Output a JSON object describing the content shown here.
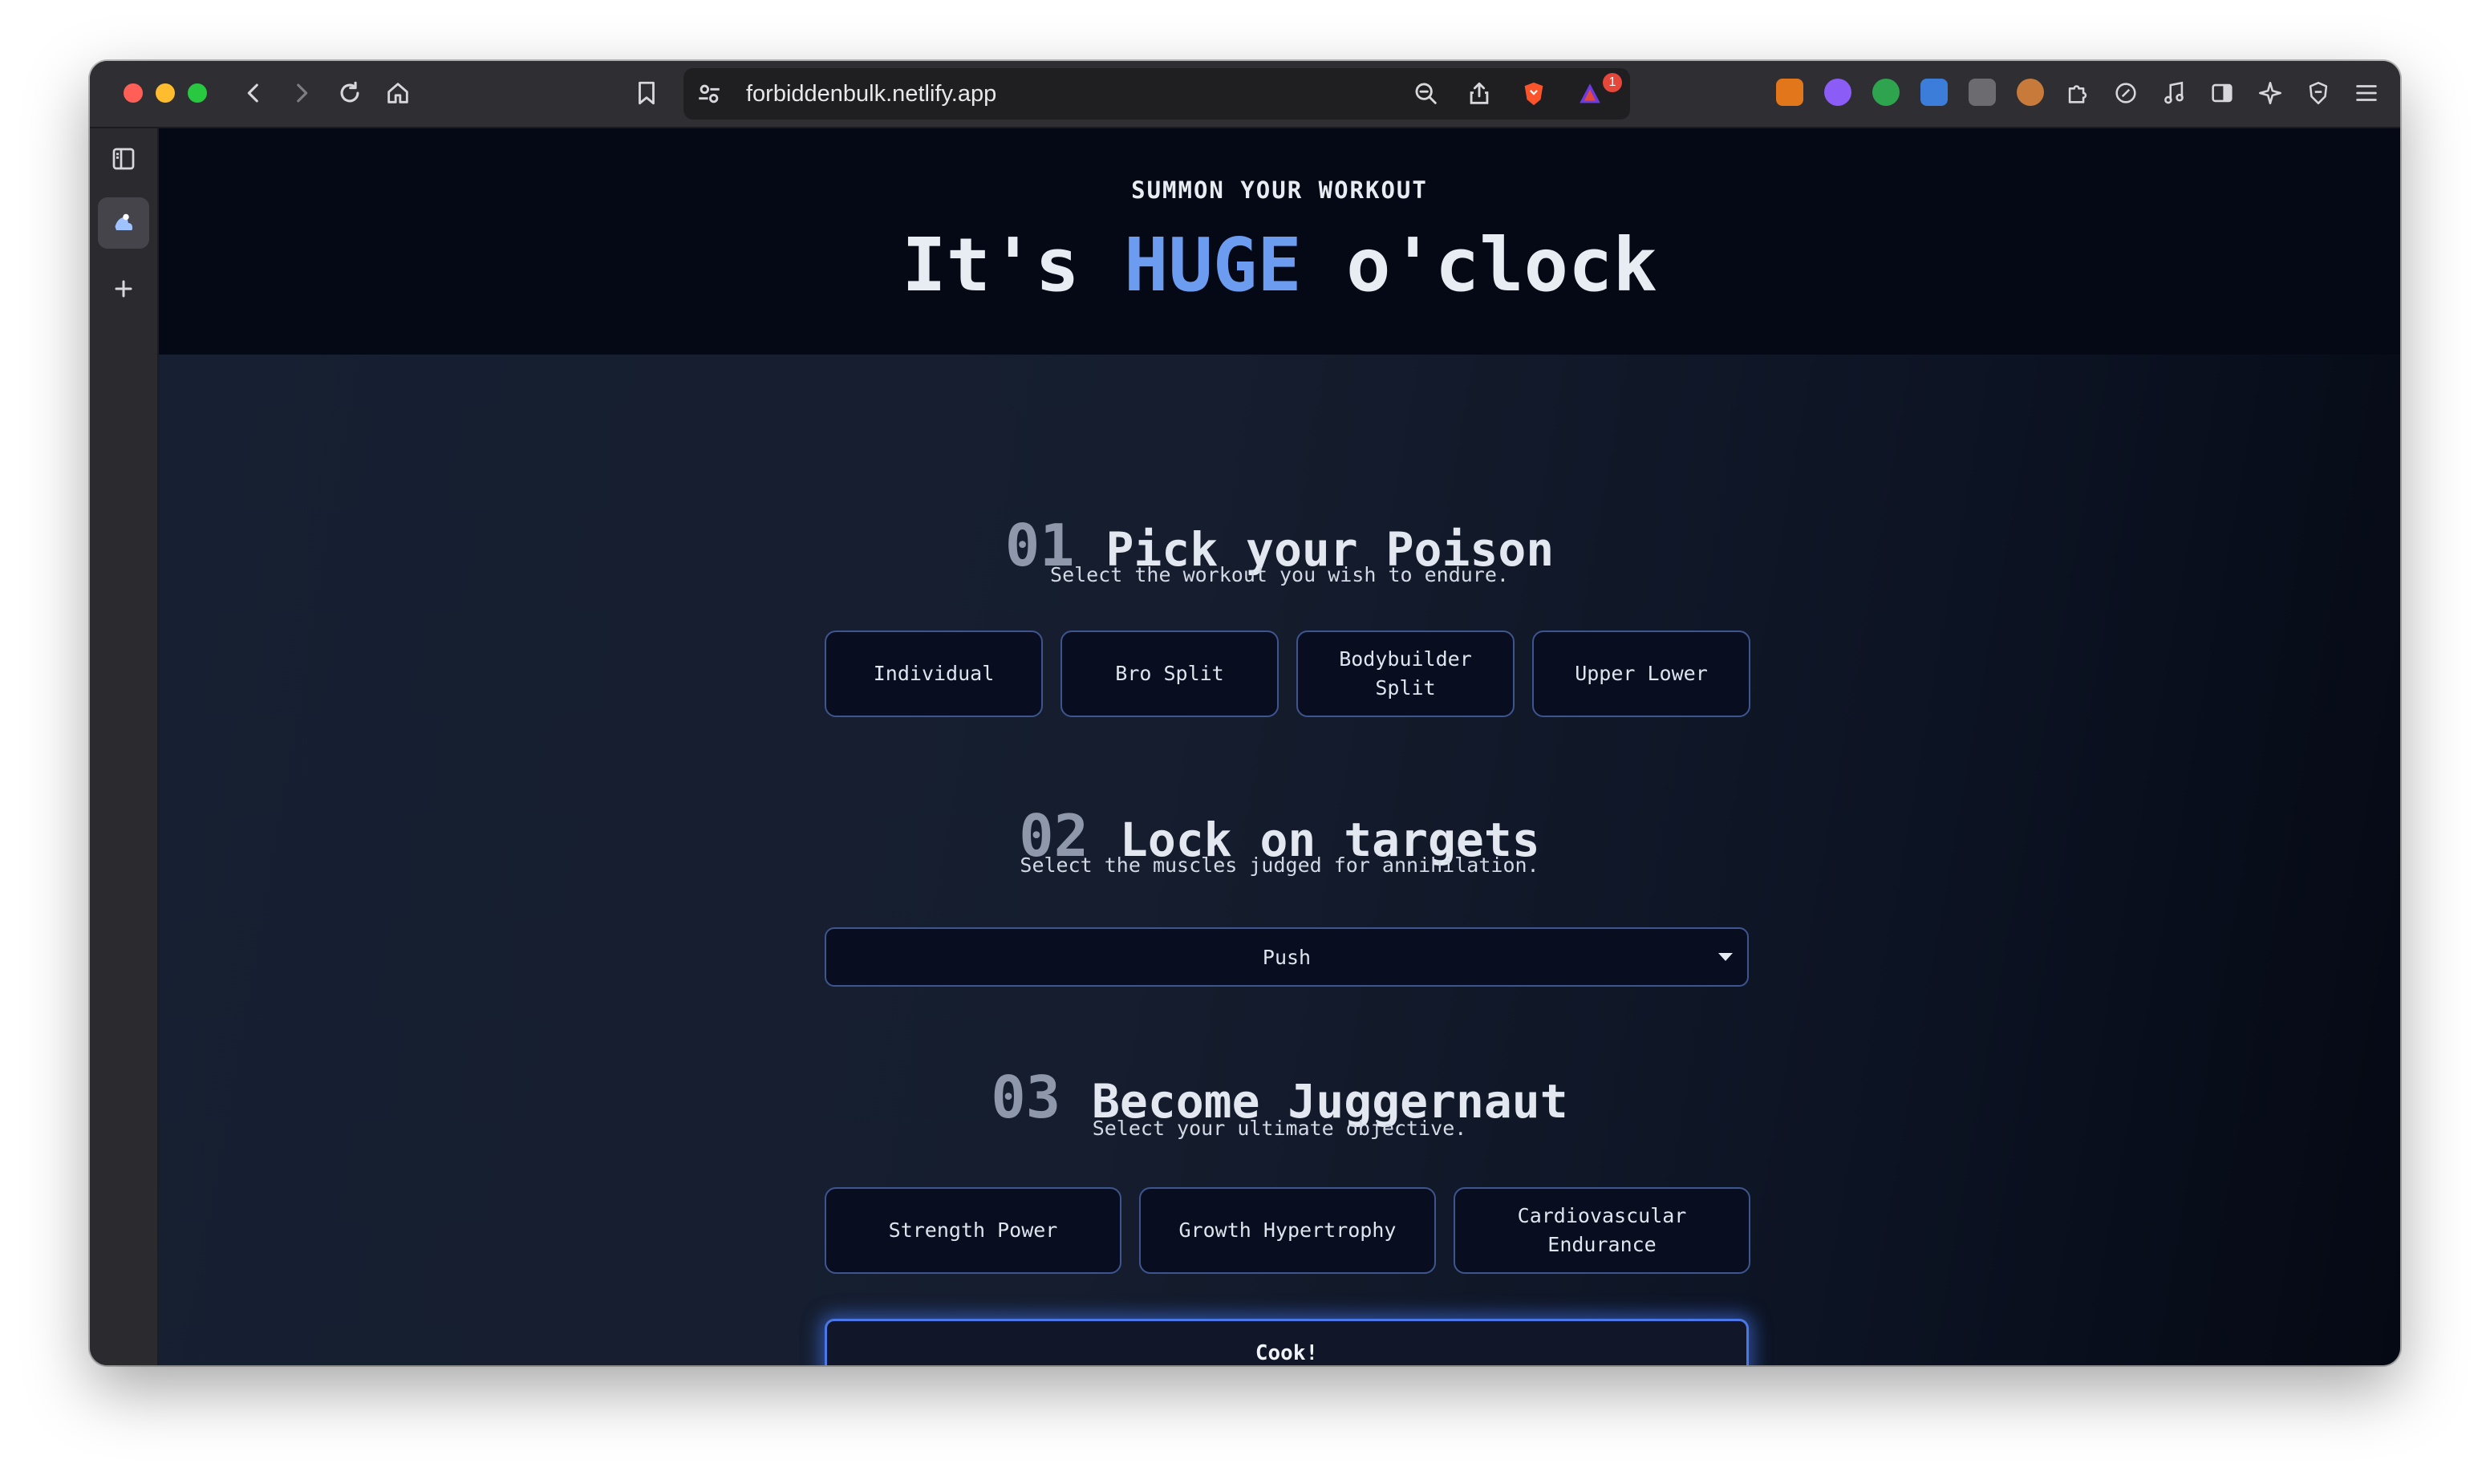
{
  "browser": {
    "url": "forbiddenbulk.netlify.app",
    "notification_count": "1",
    "icons": [
      "back-icon",
      "forward-icon",
      "reload-icon",
      "home-icon",
      "bookmark-icon",
      "site-settings-icon",
      "zoom-out-icon",
      "share-icon",
      "brave-shield-icon",
      "brave-rewards-icon",
      "metamask-icon",
      "extension-icon",
      "sidebar-toggle-icon",
      "leo-icon",
      "vpn-icon",
      "menu-icon"
    ]
  },
  "hero": {
    "eyebrow": "SUMMON YOUR WORKOUT",
    "headline_pre": "It's ",
    "headline_accent": "HUGE",
    "headline_post": " o'clock"
  },
  "step1": {
    "number": "01",
    "title": "Pick your Poison",
    "subtitle": "Select the workout you wish to endure.",
    "options": [
      "Individual",
      "Bro Split",
      "Bodybuilder Split",
      "Upper Lower"
    ]
  },
  "step2": {
    "number": "02",
    "title": "Lock on targets",
    "subtitle": "Select the muscles judged for annihilation.",
    "selected": "Push"
  },
  "step3": {
    "number": "03",
    "title": "Become Juggernaut",
    "subtitle": "Select your ultimate objective.",
    "options": [
      "Strength Power",
      "Growth Hypertrophy",
      "Cardiovascular Endurance"
    ]
  },
  "cta": {
    "label": "Cook!"
  },
  "colors": {
    "accent": "#6b9cf0",
    "border": "#3f5590",
    "glow": "#4a78e8"
  }
}
